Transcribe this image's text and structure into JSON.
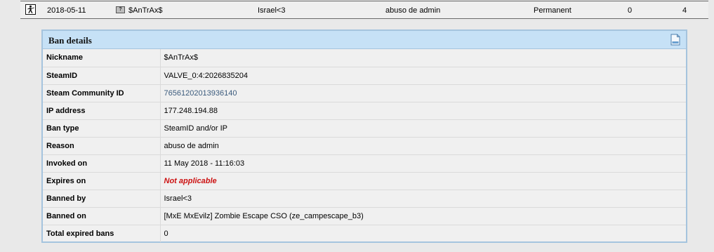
{
  "ban_row": {
    "game_icon": "counter-strike-icon",
    "date": "2018-05-11",
    "country_flag": "?",
    "player": "$AnTrAx$",
    "admin": "Israel<3",
    "reason": "abuso de admin",
    "length": "Permanent",
    "count_a": "0",
    "count_b": "4"
  },
  "details": {
    "title": "Ban details",
    "header_icon": "document-icon",
    "rows": [
      {
        "label": "Nickname",
        "value": "$AnTrAx$"
      },
      {
        "label": "SteamID",
        "value": "VALVE_0:4:2026835204"
      },
      {
        "label": "Steam Community ID",
        "value": "76561202013936140"
      },
      {
        "label": "IP address",
        "value": "177.248.194.88"
      },
      {
        "label": "Ban type",
        "value": "SteamID and/or IP"
      },
      {
        "label": "Reason",
        "value": "abuso de admin"
      },
      {
        "label": "Invoked on",
        "value": "11 May 2018 - 11:16:03"
      },
      {
        "label": "Expires on",
        "value": "Not applicable"
      },
      {
        "label": "Banned by",
        "value": "Israel<3"
      },
      {
        "label": "Banned on",
        "value": "[MxE MxEvilz] Zombie Escape CSO (ze_campescape_b3)"
      },
      {
        "label": "Total expired bans",
        "value": "0"
      }
    ]
  },
  "colors": {
    "header_bg": "#c6e1f6",
    "border": "#a5c4de",
    "not_applicable": "#cc1111",
    "link": "#3a5a7c"
  }
}
